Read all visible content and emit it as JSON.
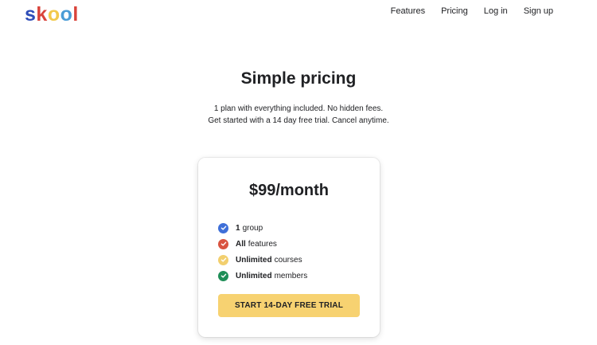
{
  "header": {
    "logo_letters": [
      {
        "char": "s",
        "color": "#2e4db8"
      },
      {
        "char": "k",
        "color": "#d9433a"
      },
      {
        "char": "o",
        "color": "#f2c94c"
      },
      {
        "char": "o",
        "color": "#4a9cd6"
      },
      {
        "char": "l",
        "color": "#d9433a"
      }
    ],
    "nav": {
      "features": "Features",
      "pricing": "Pricing",
      "login": "Log in",
      "signup": "Sign up"
    }
  },
  "hero": {
    "title": "Simple pricing",
    "subtitle_line1": "1 plan with everything included. No hidden fees.",
    "subtitle_line2": "Get started with a 14 day free trial. Cancel anytime."
  },
  "plan": {
    "price": "$99/month",
    "features": [
      {
        "bold": "1",
        "rest": "group",
        "icon": "check-circle-icon",
        "color": "#3e6fd8"
      },
      {
        "bold": "All",
        "rest": "features",
        "icon": "check-circle-icon",
        "color": "#d9533f"
      },
      {
        "bold": "Unlimited",
        "rest": "courses",
        "icon": "check-circle-icon",
        "color": "#f2cf6e"
      },
      {
        "bold": "Unlimited",
        "rest": "members",
        "icon": "check-circle-icon",
        "color": "#1e8e57"
      }
    ],
    "cta_label": "START 14-DAY FREE TRIAL",
    "cta_color": "#f7d271"
  }
}
